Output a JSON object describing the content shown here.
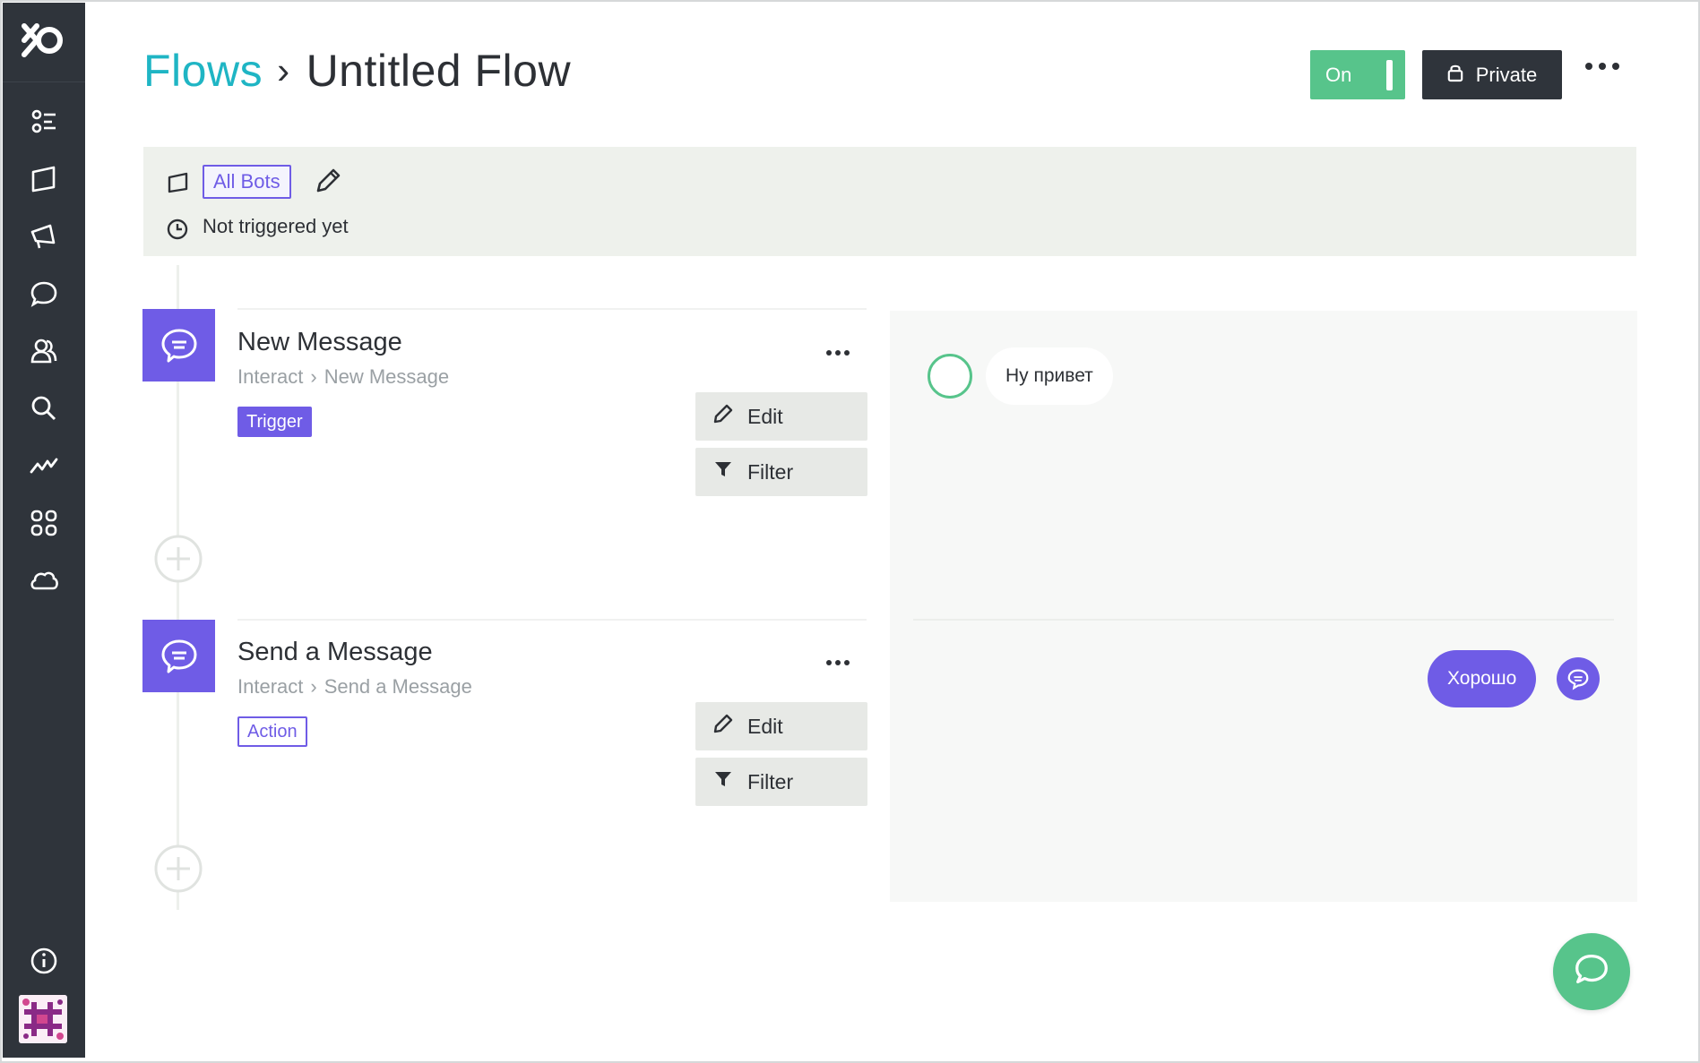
{
  "app": {
    "accent": "#6f5ce6",
    "link_color": "#1fb5c4",
    "success_color": "#57c48b",
    "sidebar_color": "#2f343b"
  },
  "sidebar": {
    "logo": "app-logo-icon",
    "items": [
      {
        "icon": "flows-icon"
      },
      {
        "icon": "bots-icon"
      },
      {
        "icon": "broadcast-icon"
      },
      {
        "icon": "chat-icon"
      },
      {
        "icon": "users-icon"
      },
      {
        "icon": "search-icon"
      },
      {
        "icon": "analytics-icon"
      },
      {
        "icon": "apps-icon"
      },
      {
        "icon": "cloud-icon"
      }
    ],
    "bottom": [
      {
        "icon": "info-icon"
      },
      {
        "icon": "user-avatar"
      }
    ]
  },
  "header": {
    "breadcrumb_root": "Flows",
    "breadcrumb_sep": "›",
    "title": "Untitled Flow",
    "toggle_label": "On",
    "privacy_label": "Private"
  },
  "trigger_bar": {
    "bots_label": "All Bots",
    "status": "Not triggered yet"
  },
  "steps": [
    {
      "title": "New Message",
      "path_root": "Interact",
      "path_sep": "›",
      "path_leaf": "New Message",
      "badge": "Trigger",
      "edit_label": "Edit",
      "filter_label": "Filter"
    },
    {
      "title": "Send a Message",
      "path_root": "Interact",
      "path_sep": "›",
      "path_leaf": "Send a Message",
      "badge": "Action",
      "edit_label": "Edit",
      "filter_label": "Filter"
    }
  ],
  "preview": {
    "incoming_message": "Ну привет",
    "outgoing_message": "Хорошо"
  }
}
